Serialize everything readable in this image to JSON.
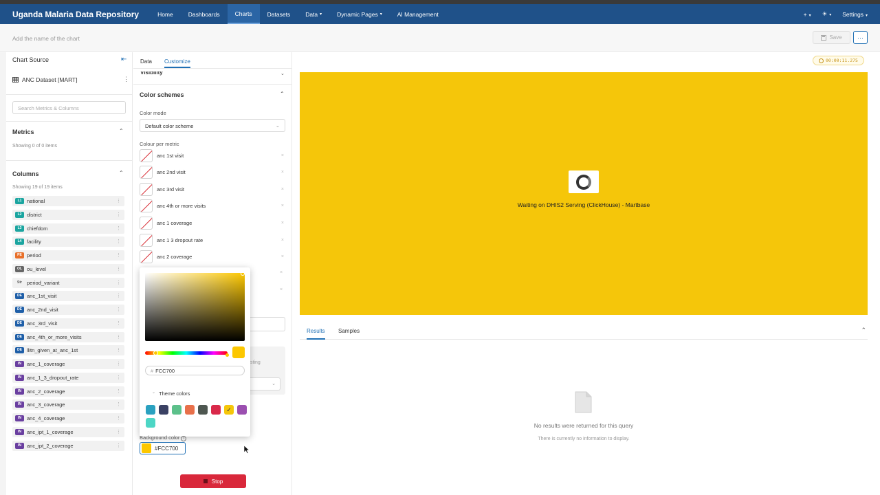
{
  "navbar": {
    "brand": "Uganda Malaria Data Repository",
    "items": [
      {
        "label": "Home",
        "active": false
      },
      {
        "label": "Dashboards",
        "active": false
      },
      {
        "label": "Charts",
        "active": true
      },
      {
        "label": "Datasets",
        "active": false
      },
      {
        "label": "Data",
        "dropdown": true
      },
      {
        "label": "Dynamic Pages",
        "dropdown": true
      },
      {
        "label": "AI Management",
        "active": false
      }
    ],
    "plus": "+",
    "settings": "Settings"
  },
  "titlebar": {
    "chart_name_placeholder": "Add the name of the chart",
    "save_label": "Save",
    "more_label": "···"
  },
  "left": {
    "chart_source_title": "Chart Source",
    "dataset": "ANC Dataset [MART]",
    "search_placeholder": "Search Metrics & Columns",
    "metrics_title": "Metrics",
    "metrics_count": "Showing 0 of 0 items",
    "columns_title": "Columns",
    "columns_count": "Showing 19 of 19 items",
    "columns": [
      {
        "badge": "L1",
        "name": "national",
        "color": "#1ba5a0"
      },
      {
        "badge": "L2",
        "name": "district",
        "color": "#1ba5a0"
      },
      {
        "badge": "L3",
        "name": "chiefdom",
        "color": "#1ba5a0"
      },
      {
        "badge": "L4",
        "name": "facility",
        "color": "#1ba5a0"
      },
      {
        "badge": "PE",
        "name": "period",
        "color": "#e8702a"
      },
      {
        "badge": "OL",
        "name": "ou_level",
        "color": "#666666"
      },
      {
        "badge": "Str",
        "name": "period_variant",
        "color": "#dddddd"
      },
      {
        "badge": "DE",
        "name": "anc_1st_visit",
        "color": "#1f5fa8"
      },
      {
        "badge": "DE",
        "name": "anc_2nd_visit",
        "color": "#1f5fa8"
      },
      {
        "badge": "DE",
        "name": "anc_3rd_visit",
        "color": "#1f5fa8"
      },
      {
        "badge": "DE",
        "name": "anc_4th_or_more_visits",
        "color": "#1f5fa8"
      },
      {
        "badge": "DE",
        "name": "llitn_given_at_anc_1st",
        "color": "#1f5fa8"
      },
      {
        "badge": "IN",
        "name": "anc_1_coverage",
        "color": "#6a3fa0"
      },
      {
        "badge": "IN",
        "name": "anc_1_3_dropout_rate",
        "color": "#6a3fa0"
      },
      {
        "badge": "IN",
        "name": "anc_2_coverage",
        "color": "#6a3fa0"
      },
      {
        "badge": "IN",
        "name": "anc_3_coverage",
        "color": "#6a3fa0"
      },
      {
        "badge": "IN",
        "name": "anc_4_coverage",
        "color": "#6a3fa0"
      },
      {
        "badge": "IN",
        "name": "anc_ipt_1_coverage",
        "color": "#6a3fa0"
      },
      {
        "badge": "IN",
        "name": "anc_ipt_2_coverage",
        "color": "#6a3fa0"
      }
    ]
  },
  "mid": {
    "tab_data": "Data",
    "tab_customize": "Customize",
    "visibility_label": "Visibility",
    "color_schemes_title": "Color schemes",
    "color_mode_label": "Color mode",
    "color_mode_value": "Default color scheme",
    "colour_per_metric_label": "Colour per metric",
    "metrics": [
      "anc 1st visit",
      "anc 2nd visit",
      "anc 3rd visit",
      "anc 4th or more visits",
      "anc 1 coverage",
      "anc 1 3 dropout rate",
      "anc 2 coverage"
    ],
    "partial_text": "sting",
    "background_color_label": "Background color",
    "background_color_value": "#FCC700",
    "stop_label": "Stop"
  },
  "picker": {
    "hex_prefix": "#",
    "hex_value": "FCC700",
    "theme_colors_label": "Theme colors",
    "theme_colors": [
      "#2aa1c0",
      "#3a4163",
      "#5cc08a",
      "#e8704a",
      "#4e5750",
      "#d9294a",
      "#f5c60a",
      "#9b4fb0",
      "#4dd6c5"
    ],
    "selected_index": 6
  },
  "right": {
    "timer": "00:00:11.275",
    "waiting_text": "Waiting on DHIS2 Serving (ClickHouse) - Martbase",
    "chart_bg": "#F5C60A",
    "tab_results": "Results",
    "tab_samples": "Samples",
    "empty_title": "No results were returned for this query",
    "empty_sub": "There is currently no information to display."
  }
}
